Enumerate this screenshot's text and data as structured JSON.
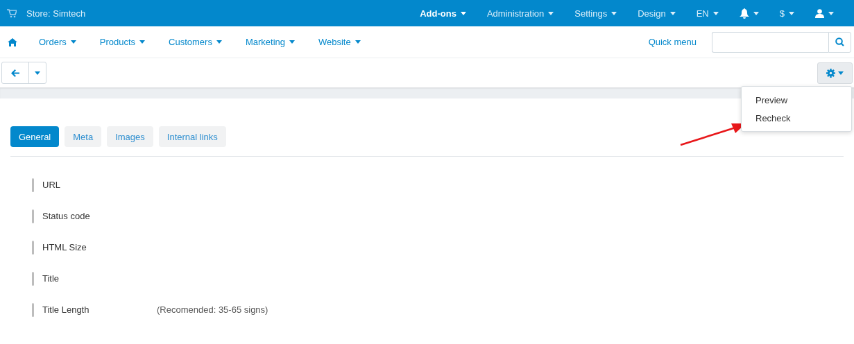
{
  "store": {
    "label": "Store: Simtech"
  },
  "top_menu": [
    {
      "label": "Add-ons",
      "selected": true
    },
    {
      "label": "Administration",
      "selected": false
    },
    {
      "label": "Settings",
      "selected": false
    },
    {
      "label": "Design",
      "selected": false
    },
    {
      "label": "EN",
      "selected": false
    }
  ],
  "top_icons": [
    {
      "kind": "bell"
    },
    {
      "kind": "text",
      "label": "$"
    },
    {
      "kind": "user"
    }
  ],
  "nav": [
    {
      "label": "Orders"
    },
    {
      "label": "Products"
    },
    {
      "label": "Customers"
    },
    {
      "label": "Marketing"
    },
    {
      "label": "Website"
    }
  ],
  "quick_menu": "Quick menu",
  "dropdown": {
    "items": [
      "Preview",
      "Recheck"
    ]
  },
  "tabs": [
    {
      "label": "General",
      "selected": true
    },
    {
      "label": "Meta",
      "selected": false
    },
    {
      "label": "Images",
      "selected": false
    },
    {
      "label": "Internal links",
      "selected": false
    }
  ],
  "fields": [
    {
      "label": "URL"
    },
    {
      "label": "Status code"
    },
    {
      "label": "HTML Size"
    },
    {
      "label": "Title"
    },
    {
      "label": "Title Length",
      "note": "(Recomended: 35-65 signs)"
    }
  ]
}
